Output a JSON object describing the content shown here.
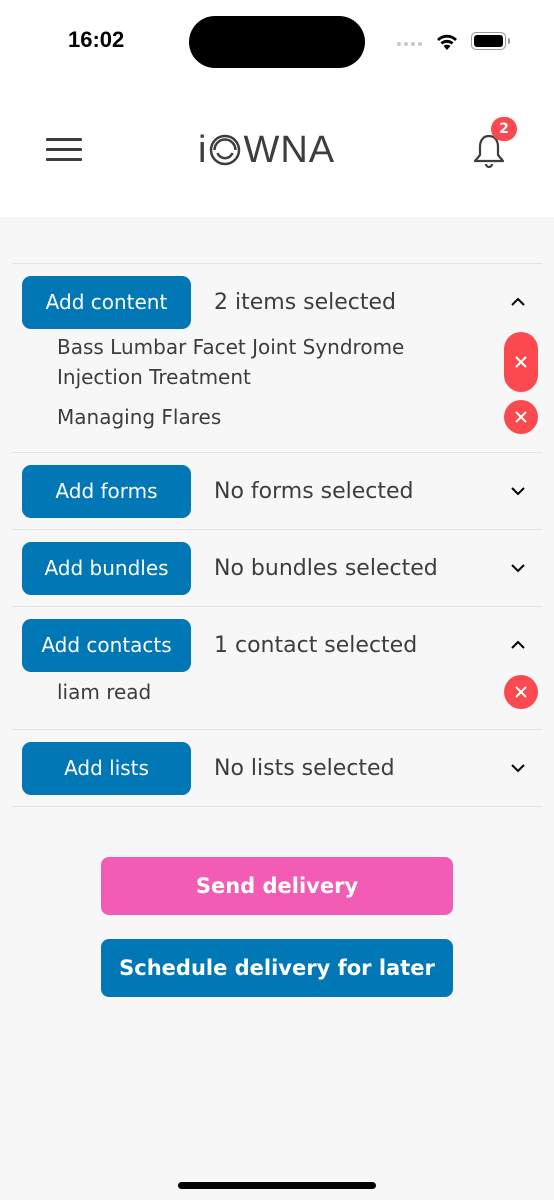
{
  "status_bar": {
    "time": "16:02"
  },
  "header": {
    "logo_text_left": "i",
    "logo_text_right": "WNA",
    "notification_count": "2"
  },
  "sections": [
    {
      "button_label": "Add content",
      "summary": "2 items selected",
      "expanded": true,
      "items": [
        "Bass Lumbar Facet Joint Syndrome Injection Treatment",
        "Managing Flares"
      ]
    },
    {
      "button_label": "Add forms",
      "summary": "No forms selected",
      "expanded": false,
      "items": []
    },
    {
      "button_label": "Add bundles",
      "summary": "No bundles selected",
      "expanded": false,
      "items": []
    },
    {
      "button_label": "Add contacts",
      "summary": "1 contact selected",
      "expanded": true,
      "items": [
        "liam read"
      ]
    },
    {
      "button_label": "Add lists",
      "summary": "No lists selected",
      "expanded": false,
      "items": []
    }
  ],
  "actions": {
    "send_label": "Send delivery",
    "schedule_label": "Schedule delivery for later"
  },
  "colors": {
    "primary": "#0177b6",
    "send": "#f25cb5",
    "danger": "#fa4a4f"
  }
}
